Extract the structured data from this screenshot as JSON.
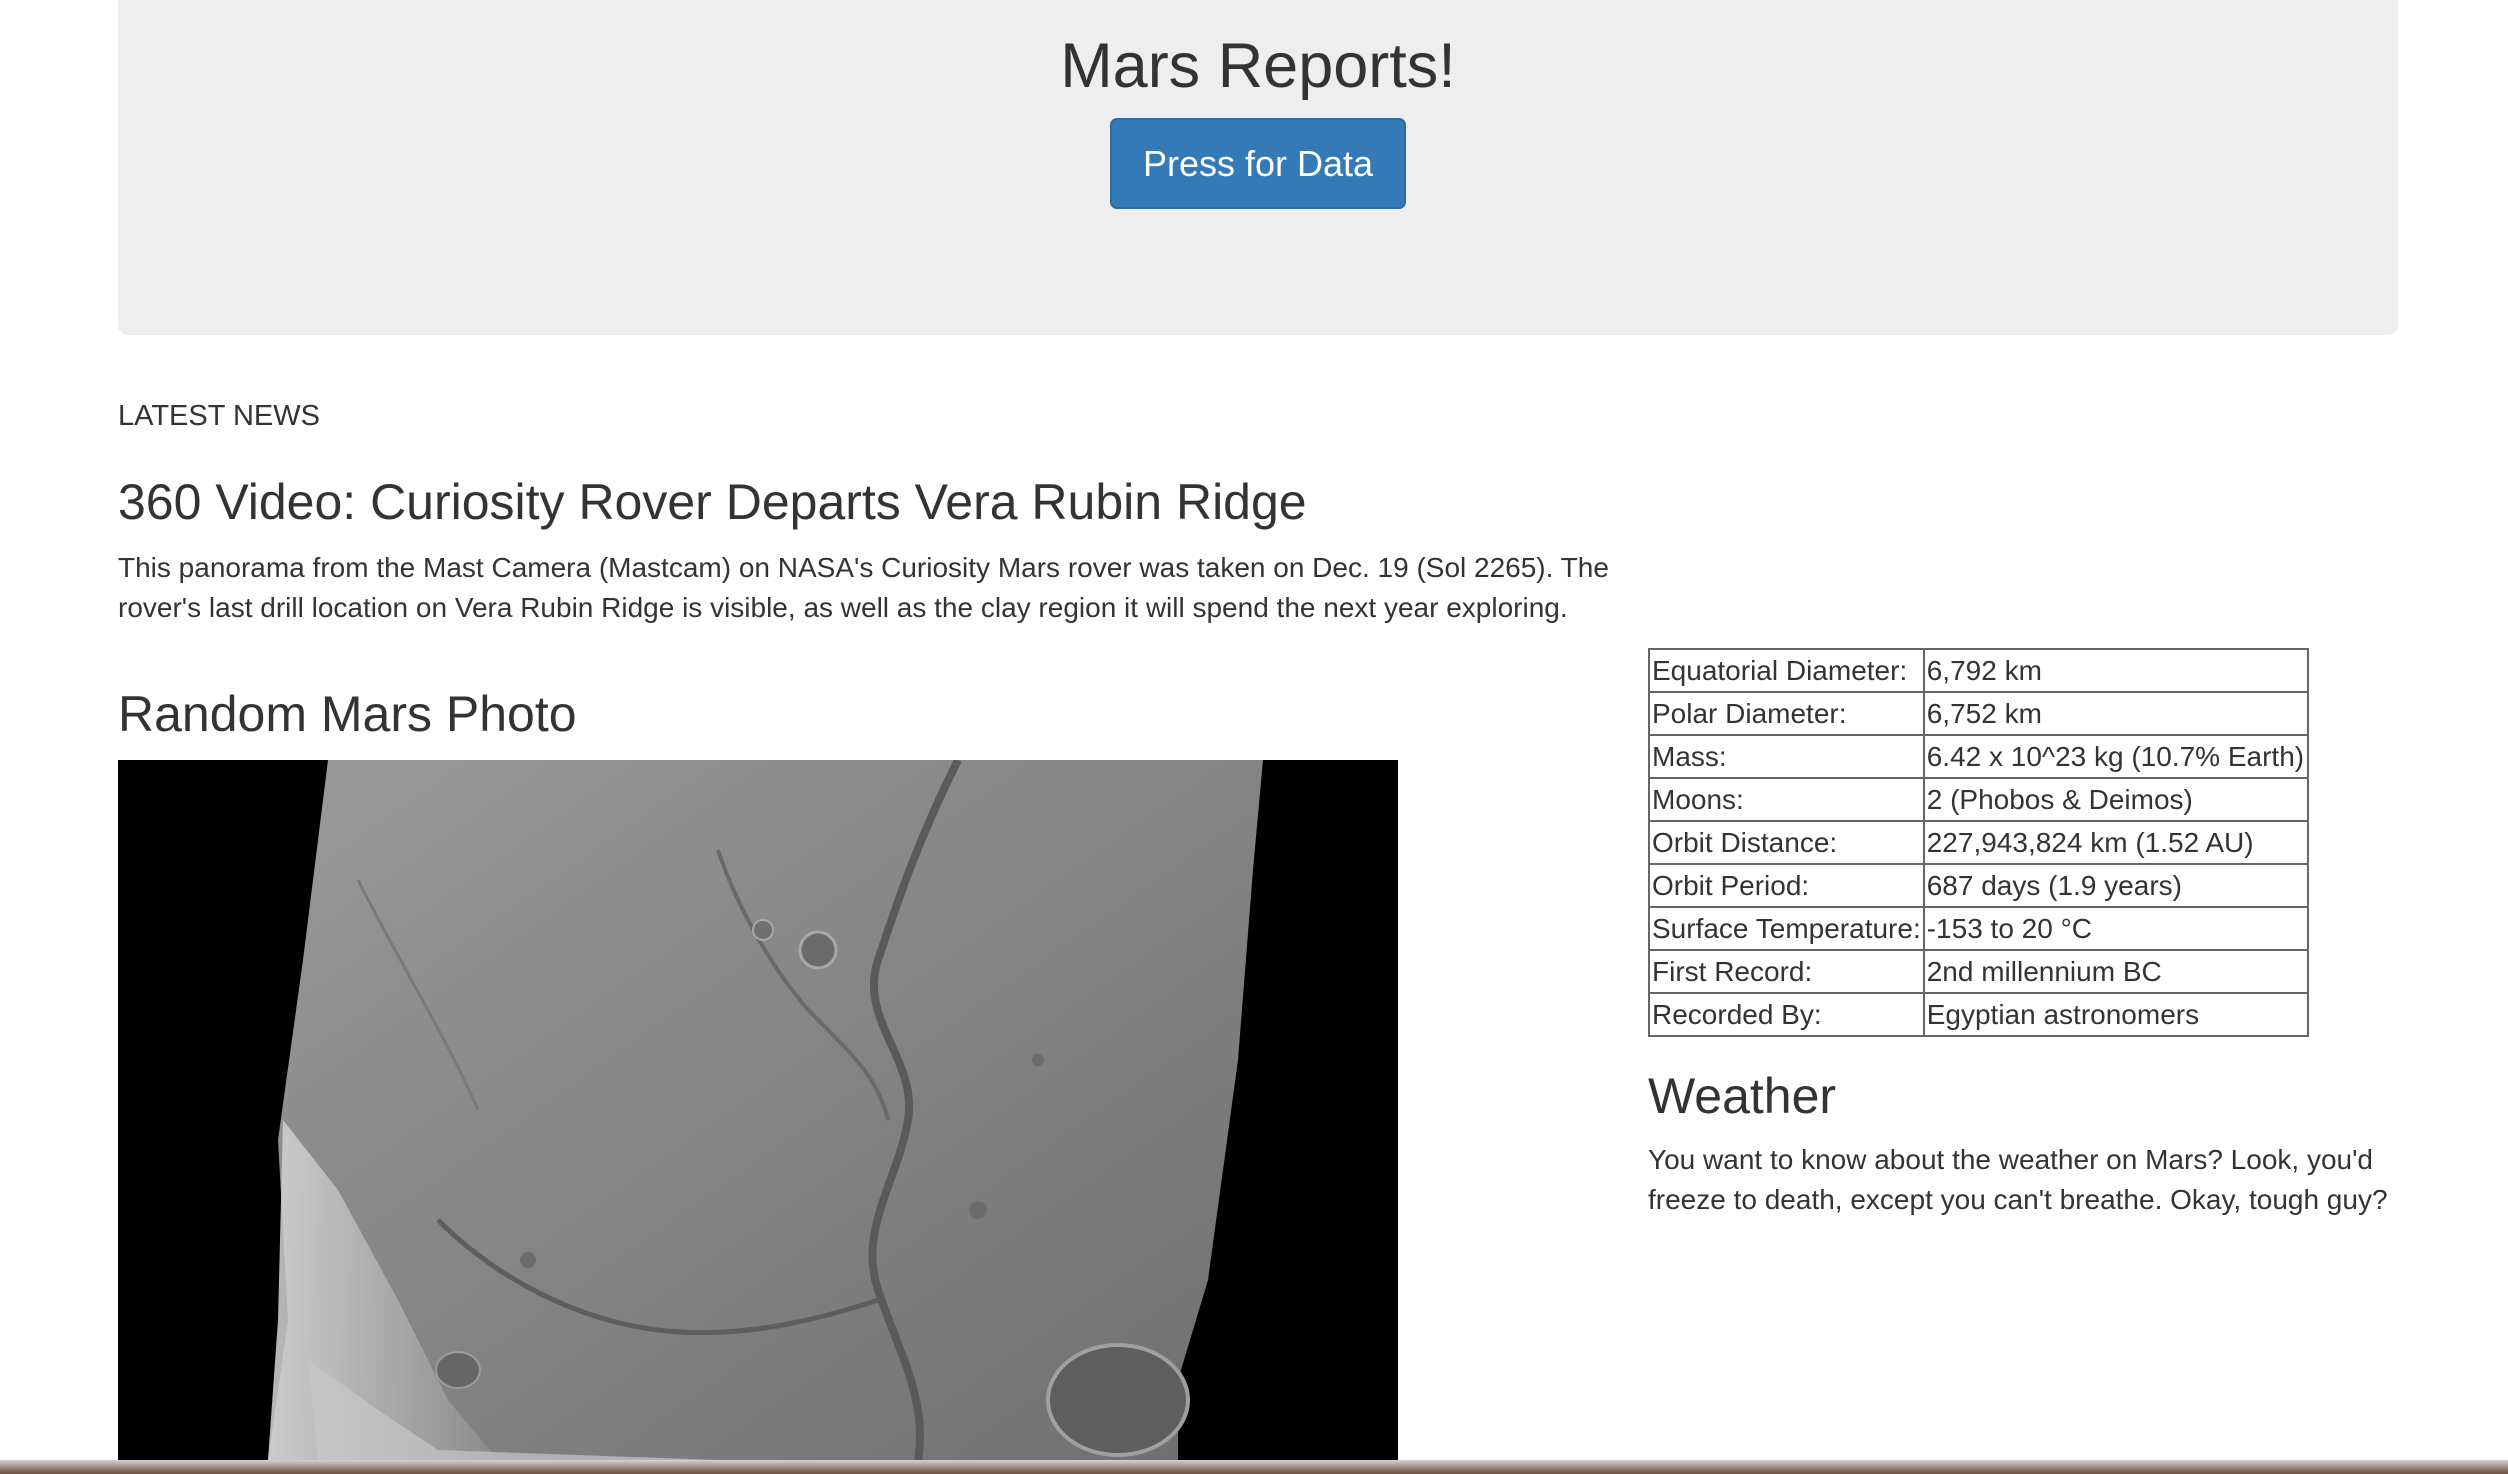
{
  "header": {
    "title": "Mars Reports!",
    "button_label": "Press for Data"
  },
  "news": {
    "section_label": "LATEST NEWS",
    "title": "360 Video: Curiosity Rover Departs Vera Rubin Ridge",
    "body": "This panorama from the Mast Camera (Mastcam) on NASA's Curiosity Mars rover was taken on Dec. 19 (Sol 2265). The rover's last drill location on Vera Rubin Ridge is visible, as well as the clay region it will spend the next year exploring."
  },
  "photo": {
    "title": "Random Mars Photo"
  },
  "facts": {
    "rows": [
      {
        "label": "Equatorial Diameter:",
        "value": "6,792 km"
      },
      {
        "label": "Polar Diameter:",
        "value": "6,752 km"
      },
      {
        "label": "Mass:",
        "value": "6.42 x 10^23 kg (10.7% Earth)"
      },
      {
        "label": "Moons:",
        "value": "2 (Phobos & Deimos)"
      },
      {
        "label": "Orbit Distance:",
        "value": "227,943,824 km (1.52 AU)"
      },
      {
        "label": "Orbit Period:",
        "value": "687 days (1.9 years)"
      },
      {
        "label": "Surface Temperature:",
        "value": "-153 to 20 °C"
      },
      {
        "label": "First Record:",
        "value": "2nd millennium BC"
      },
      {
        "label": "Recorded By:",
        "value": "Egyptian astronomers"
      }
    ]
  },
  "weather": {
    "title": "Weather",
    "body": "You want to know about the weather on Mars? Look, you'd freeze to death, except you can't breathe. Okay, tough guy?"
  }
}
